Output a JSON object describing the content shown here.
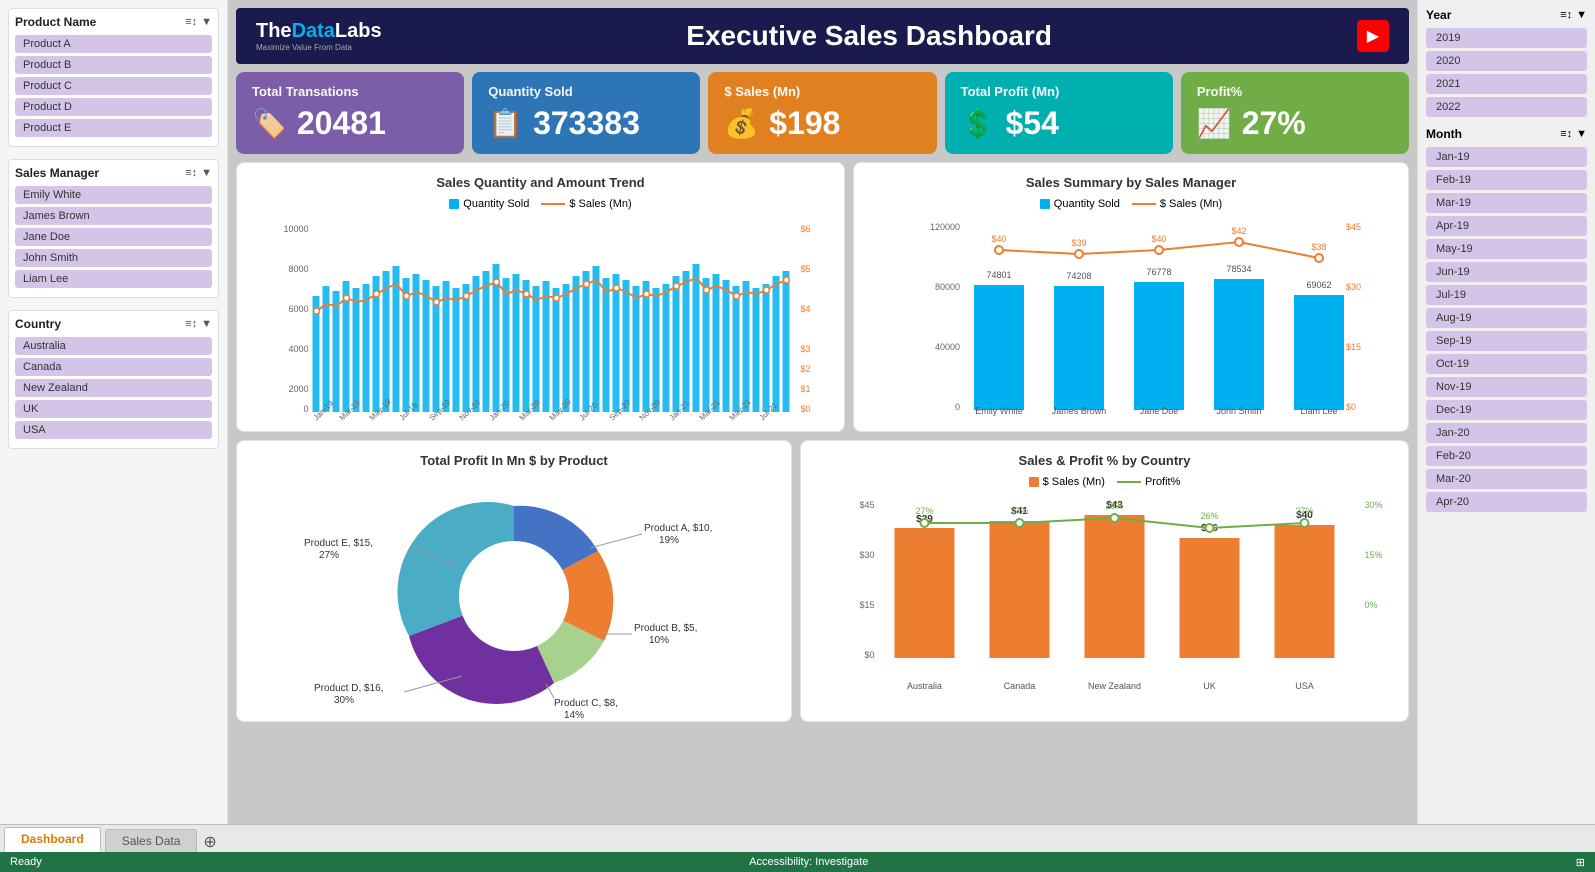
{
  "app": {
    "status": "Ready",
    "accessibility": "Accessibility: Investigate"
  },
  "header": {
    "logo_main": "TheDataLabs",
    "logo_the": "The",
    "logo_data": "Data",
    "logo_labs": "Labs",
    "logo_subtitle": "Maximize Value From Data",
    "title": "Executive Sales Dashboard"
  },
  "kpis": [
    {
      "id": "total-transactions",
      "label": "Total Transations",
      "value": "20481",
      "icon": "🔖",
      "color": "purple"
    },
    {
      "id": "quantity-sold",
      "label": "Quantity Sold",
      "value": "373383",
      "icon": "📋",
      "color": "blue"
    },
    {
      "id": "sales-mn",
      "label": "$ Sales (Mn)",
      "value": "$198",
      "icon": "💰",
      "color": "orange"
    },
    {
      "id": "total-profit",
      "label": "Total Profit (Mn)",
      "value": "$54",
      "icon": "💲",
      "color": "cyan"
    },
    {
      "id": "profit-pct",
      "label": "Profit%",
      "value": "27%",
      "icon": "📊",
      "color": "green"
    }
  ],
  "filters": {
    "product": {
      "title": "Product Name",
      "items": [
        "Product A",
        "Product B",
        "Product C",
        "Product D",
        "Product E"
      ]
    },
    "sales_manager": {
      "title": "Sales Manager",
      "items": [
        "Emily White",
        "James Brown",
        "Jane Doe",
        "John Smith",
        "Liam Lee"
      ]
    },
    "country": {
      "title": "Country",
      "items": [
        "Australia",
        "Canada",
        "New Zealand",
        "UK",
        "USA"
      ]
    }
  },
  "year_filter": {
    "title": "Year",
    "items": [
      "2019",
      "2020",
      "2021",
      "2022"
    ]
  },
  "month_filter": {
    "title": "Month",
    "items": [
      "Jan-19",
      "Feb-19",
      "Mar-19",
      "Apr-19",
      "May-19",
      "Jun-19",
      "Jul-19",
      "Aug-19",
      "Sep-19",
      "Oct-19",
      "Nov-19",
      "Dec-19",
      "Jan-20",
      "Feb-20",
      "Mar-20",
      "Apr-20"
    ]
  },
  "chart1": {
    "title": "Sales Quantity and Amount Trend",
    "legend": [
      "Quantity Sold",
      "$ Sales (Mn)"
    ],
    "bar_color": "#00b0f0",
    "line_color": "#ed7d31"
  },
  "chart2": {
    "title": "Sales Summary by Sales Manager",
    "legend": [
      "Quantity Sold",
      "$ Sales (Mn)"
    ],
    "managers": [
      "Emily White",
      "James Brown",
      "Jane Doe",
      "John Smith",
      "Liam Lee"
    ],
    "bar_values": [
      74801,
      74208,
      76778,
      78534,
      69062
    ],
    "line_values": [
      40,
      39,
      40,
      42,
      38
    ],
    "bar_color": "#00b0f0",
    "line_color": "#ed7d31"
  },
  "chart3": {
    "title": "Total Profit In Mn $ by Product",
    "segments": [
      {
        "name": "Product A",
        "value": 10,
        "pct": "19%",
        "color": "#4472c4"
      },
      {
        "name": "Product B",
        "value": 5,
        "pct": "10%",
        "color": "#ed7d31"
      },
      {
        "name": "Product C",
        "value": 8,
        "pct": "14%",
        "color": "#a9d18e"
      },
      {
        "name": "Product D",
        "value": 16,
        "pct": "30%",
        "color": "#7030a0"
      },
      {
        "name": "Product E",
        "value": 15,
        "pct": "27%",
        "color": "#4bacc6"
      }
    ]
  },
  "chart4": {
    "title": "Sales & Profit % by Country",
    "legend": [
      "$ Sales (Mn)",
      "Profit%"
    ],
    "countries": [
      "Australia",
      "Canada",
      "New Zealand",
      "UK",
      "USA"
    ],
    "bar_values": [
      39,
      41,
      43,
      36,
      40
    ],
    "line_values": [
      27,
      27,
      28,
      26,
      27
    ],
    "bar_color": "#ed7d31",
    "line_color": "#70ad47"
  },
  "tabs": [
    {
      "id": "dashboard",
      "label": "Dashboard",
      "active": true
    },
    {
      "id": "sales-data",
      "label": "Sales Data",
      "active": false
    }
  ]
}
